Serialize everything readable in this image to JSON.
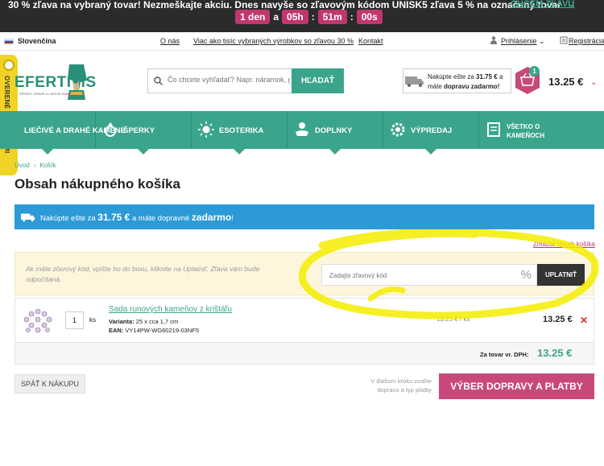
{
  "top_banner": {
    "promo_text": "30 % zľava na vybraný tovar! Nezmeškajte akciu. Dnes navyše so zľavovým kódom UNISK5 zľava 5 % na označený tovar",
    "timer": {
      "days": "1 den",
      "a": "a",
      "hours": "05h",
      "minutes": "51m",
      "seconds": "00s",
      "sep": ":"
    },
    "cta_label": "CHCEM ZĽAVU",
    "cta_arrow": "→"
  },
  "info_bar": {
    "language": "Slovenčina",
    "links": [
      "O nás",
      "Viac ako tisíc vybraných výrobkov so zľavou 30 %",
      "Kontakt"
    ],
    "login": "Prihlásenie",
    "login_chevron": "⌄",
    "register": "Registrácia"
  },
  "logo": {
    "name": "EFERTITIS",
    "tagline": "ŠPERKY, DRAHÉ A LIEČIVÉ KAMENE"
  },
  "search": {
    "placeholder": "Čo chcete vyhľadať? Napr. náramok, granát...",
    "button": "HĽADAŤ"
  },
  "shipping_box": {
    "line1_prefix": "Nakúpte ešte za ",
    "line1_amount": "31.75 €",
    "line1_suffix": " a",
    "line2_prefix": "máte ",
    "line2_bold": "dopravu zadarmo!"
  },
  "cart": {
    "badge": "1",
    "total": "13.25 €",
    "chevron": "⌄"
  },
  "side_badge": {
    "label": "OVERENÉ ZÁKAZNÍKMI"
  },
  "nav": {
    "items": [
      {
        "label": "LIEČIVÉ A DRAHÉ KAMENE",
        "icon": "stone-icon"
      },
      {
        "label": "ŠPERKY",
        "icon": "jewelry-icon"
      },
      {
        "label": "ESOTERIKA",
        "icon": "sun-icon"
      },
      {
        "label": "DOPLNKY",
        "icon": "hand-icon"
      },
      {
        "label": "VÝPREDAJ",
        "icon": "gear-icon"
      },
      {
        "label": "VŠETKO O KAMEŇOCH",
        "icon": "book-icon"
      }
    ]
  },
  "breadcrumb": {
    "home": "Úvod",
    "sep": "›",
    "current": "Košík"
  },
  "page_title": "Obsah nákupného košíka",
  "free_shipping_bar": {
    "prefix": "Nakúpte ešte za ",
    "amount": "31.75 €",
    "middle": " a máte dopravné ",
    "bold": "zadarmo",
    "suffix": "!"
  },
  "delete_cart": "Zmazať obsah košíka",
  "coupon": {
    "info": "Ak máte zľavový kód, vpíšte ho do boxu, kliknite na Uplatniť. Zľava vám bude odpočítaná.",
    "placeholder": "Zadajte zľavový kód",
    "percent": "%",
    "button": "UPLATNIŤ"
  },
  "cart_items": [
    {
      "qty": "1",
      "unit": "ks",
      "name": "Sada runových kameňov z krištáľu",
      "variant_label": "Varianta:",
      "variant": " 25 x cca 1,7 cm",
      "ean_label": "EAN:",
      "ean": " VY14PW-WG60219-03NF5",
      "unit_price": "13.25 € / ks",
      "line_price": "13.25 €",
      "remove": "✕"
    }
  ],
  "totals": {
    "label": "Za tovar vr. DPH:",
    "value": "13.25 €"
  },
  "footer": {
    "back_button": "SPÄŤ K NÁKUPU",
    "next_note": "V ďalšom kroku zvolíte dopravu a typ platby",
    "next_button": "VÝBER DOPRAVY A PLATBY"
  },
  "colors": {
    "accent": "#3aa58c",
    "pink": "#c2366e",
    "blue": "#2c9ad7",
    "highlight": "#f5ec00"
  }
}
